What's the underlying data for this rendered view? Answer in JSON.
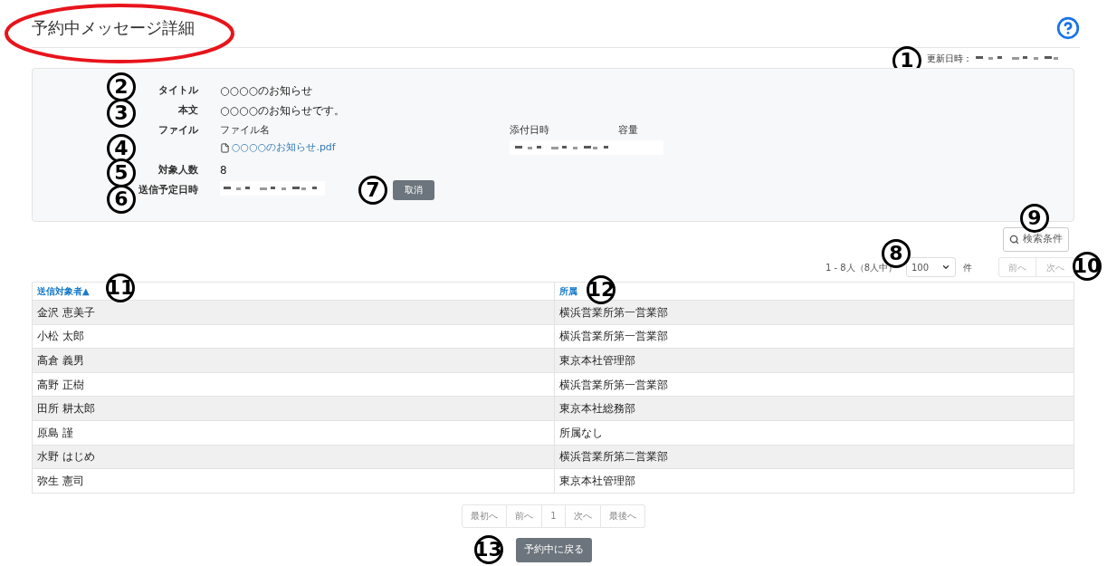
{
  "page": {
    "title": "予約中メッセージ詳細",
    "title_highlighted": true
  },
  "updated": {
    "label": "更新日時：",
    "callout": "1"
  },
  "details": [
    {
      "kind": "text",
      "label": "タイトル",
      "value": "○○○○のお知らせ",
      "callout": "2"
    },
    {
      "kind": "text",
      "label": "本文",
      "value": "○○○○のお知らせです。",
      "callout": "3"
    },
    {
      "kind": "file",
      "label": "ファイル",
      "header": "ファイル名",
      "file": "○○○○のお知らせ.pdf",
      "callout": "4"
    },
    {
      "kind": "text",
      "label": "対象人数",
      "value": "8",
      "callout": "5"
    },
    {
      "kind": "schedule",
      "label": "送信予定日時",
      "callout": "6"
    }
  ],
  "attachment": {
    "columns": [
      "添付日時",
      "容量"
    ]
  },
  "cancel_button": {
    "label": "取消",
    "callout": "7"
  },
  "search_button": {
    "label": "検索条件",
    "callout": "9"
  },
  "result_count": {
    "text": "1 - 8人（8人中）",
    "callout": "8"
  },
  "page_size": {
    "value": "100",
    "unit": "件"
  },
  "top_pager": {
    "buttons": [
      "前へ",
      "次へ"
    ],
    "callout": "10"
  },
  "table": {
    "columns": [
      {
        "label": "送信対象者▲",
        "callout": "11"
      },
      {
        "label": "所属",
        "callout": "12"
      }
    ],
    "rows": [
      [
        "金沢 恵美子",
        "横浜営業所第一営業部"
      ],
      [
        "小松 太郎",
        "横浜営業所第一営業部"
      ],
      [
        "高倉 義男",
        "東京本社管理部"
      ],
      [
        "高野 正樹",
        "横浜営業所第一営業部"
      ],
      [
        "田所 耕太郎",
        "東京本社総務部"
      ],
      [
        "原島 謹",
        "所属なし"
      ],
      [
        "水野 はじめ",
        "横浜営業所第二営業部"
      ],
      [
        "弥生 憲司",
        "東京本社管理部"
      ]
    ]
  },
  "pager": [
    "最初へ",
    "前へ",
    "1",
    "次へ",
    "最後へ"
  ],
  "back_button": {
    "label": "予約中に戻る",
    "callout": "13"
  }
}
